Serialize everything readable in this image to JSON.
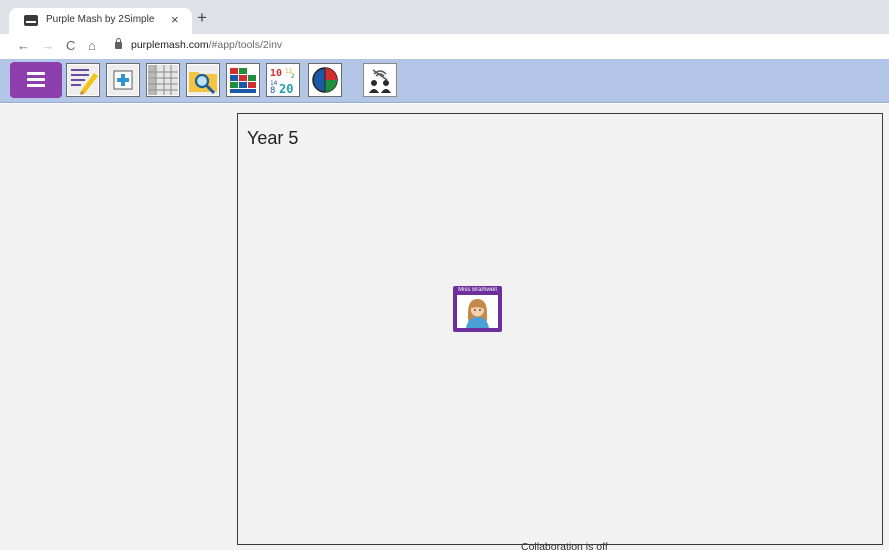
{
  "browser": {
    "tab_title": "Purple Mash by 2Simple",
    "tab_close": "×",
    "new_tab": "+",
    "back": "←",
    "forward": "→",
    "reload": "C",
    "home": "⌂",
    "url_host": "purplemash.com",
    "url_path": "/#app/tools/2inv"
  },
  "toolbar": {
    "menu": "main-menu",
    "icons": [
      "edit-record-icon",
      "add-record-icon",
      "table-view-icon",
      "search-folder-icon",
      "sort-chart-icon",
      "number-grid-icon",
      "pie-chart-icon",
      "collaboration-users-icon"
    ]
  },
  "canvas": {
    "title": "Year 5",
    "card_name": "Miss Bramwell",
    "card_avatar": "teacher-avatar-icon"
  },
  "status": {
    "collaboration": "Collaboration is off"
  },
  "colors": {
    "toolbar_bg": "#b3c6e8",
    "menu_purple": "#8e3fae",
    "card_purple": "#6d2f9e",
    "canvas_bg": "#f2f2f2"
  }
}
